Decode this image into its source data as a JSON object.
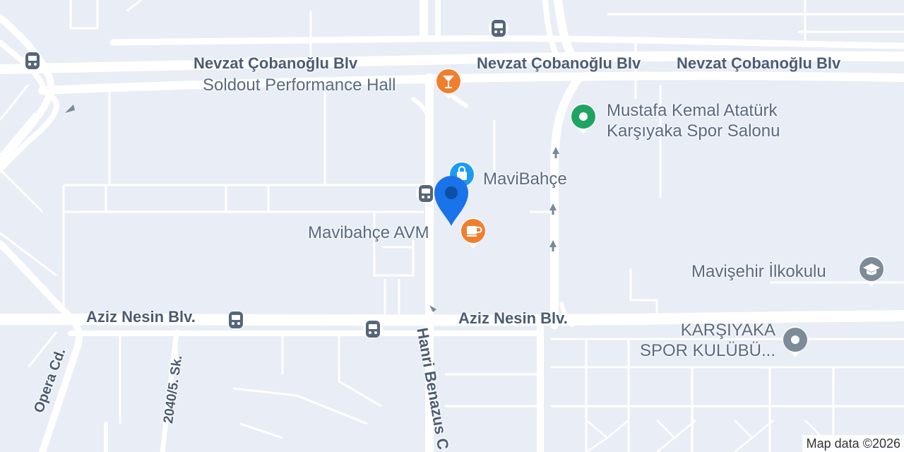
{
  "map": {
    "roads": {
      "top_1": "Nevzat Çobanoğlu Blv",
      "top_2": "Nevzat Çobanoğlu Blv",
      "top_3": "Nevzat Çobanoğlu Blv",
      "aziz_west": "Aziz Nesin Blv.",
      "aziz_east": "Aziz Nesin Blv.",
      "hanri": "Hanri Benazus C",
      "opera": "Opera Cd.",
      "sk2040": "2040/5. Sk."
    },
    "pois": {
      "soldout": {
        "name": "Soldout Performance Hall",
        "icon": "cocktail-icon",
        "color": "#ef7f2f"
      },
      "mustafa": {
        "line1": "Mustafa Kemal Atatürk",
        "line2": "Karşıyaka Spor Salonu",
        "icon": "sports-icon",
        "color": "#1ea362"
      },
      "mavibahce": {
        "name": "MaviBahçe",
        "icon": "shopping-icon",
        "color": "#1d9bf0"
      },
      "avm": {
        "name": "Mavibahçe AVM",
        "icon": "coffee-icon",
        "color": "#ef7f2f"
      },
      "ilkokul": {
        "name": "Mavişehir İlkokulu",
        "icon": "school-icon",
        "color": "#7d8b99"
      },
      "kulubu": {
        "line1": "KARŞIYAKA",
        "line2": "SPOR KULÜBÜ...",
        "icon": "place-icon",
        "color": "#7d8b99"
      }
    },
    "selected_marker": {
      "icon": "location-pin-icon",
      "color": "#1a73e8"
    },
    "transit_icons": [
      "tram-stop-icon",
      "bus-stop-icon"
    ],
    "attribution": "Map data ©2026"
  }
}
